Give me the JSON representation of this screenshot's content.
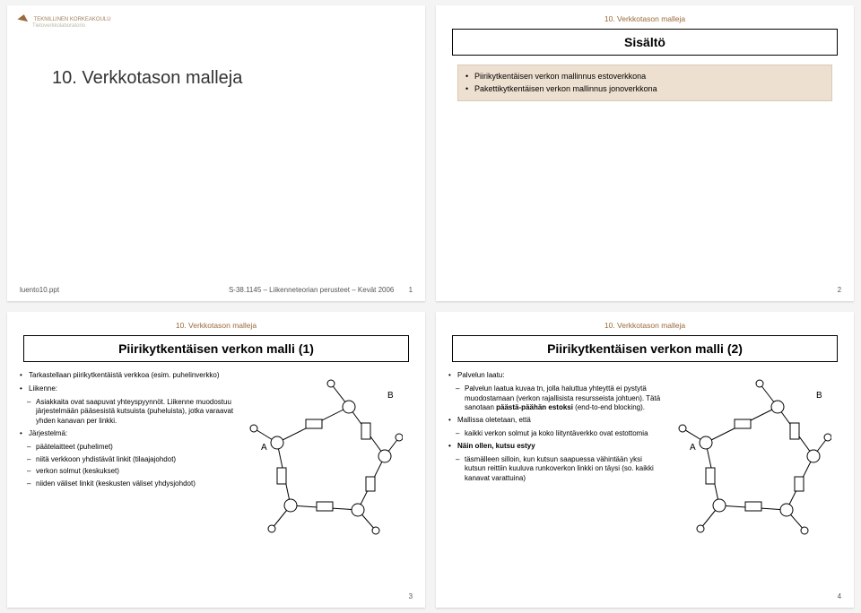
{
  "header": {
    "section_label": "10. Verkkotason malleja"
  },
  "slide1": {
    "logo_line1": "TEKNILLINEN KORKEAKOULU",
    "logo_line2": "Tietoverkkolaboratorio",
    "big_title": "10. Verkkotason malleja",
    "footer_left": "luento10.ppt",
    "footer_center": "S-38.1145 – Liikenneteorian perusteet – Kevät 2006",
    "footer_right": "1"
  },
  "slide2": {
    "title": "Sisältö",
    "bullets": [
      "Piirikytkentäisen verkon mallinnus estoverkkona",
      "Pakettikytkentäisen verkon mallinnus jonoverkkona"
    ],
    "page": "2"
  },
  "slide3": {
    "title": "Piirikytkentäisen verkon malli (1)",
    "bullets": {
      "intro": "Tarkastellaan piirikytkentäistä verkkoa (esim. puhelinverkko)",
      "liikenne_head": "Liikenne:",
      "liikenne_body": "Asiakkaita ovat saapuvat yhteyspyynnöt. Liikenne muodostuu järjestelmään pääsesistä kutsuista (puheluista), jotka varaavat yhden kanavan per linkki.",
      "jarj_head": "Järjestelmä:",
      "jarj_items": [
        "päätelaitteet (puhelimet)",
        "niitä verkkoon yhdistävät linkit (tilaajajohdot)",
        "verkon solmut (keskukset)",
        "niiden väliset linkit (keskusten väliset yhdysjohdot)"
      ]
    },
    "graph": {
      "A": "A",
      "B": "B"
    },
    "page": "3"
  },
  "slide4": {
    "title": "Piirikytkentäisen verkon malli (2)",
    "bullets": {
      "laatu_head": "Palvelun laatu:",
      "laatu_body1": "Palvelun laatua kuvaa tn, jolla haluttua yhteyttä ei pystytä muodostamaan (verkon rajallisista resursseista johtuen).",
      "laatu_body2_pre": "Tätä sanotaan ",
      "laatu_body2_bold": "päästä-päähän estoksi",
      "laatu_body2_post": " (end-to-end blocking).",
      "mallissa_head": "Mallissa oletetaan, että",
      "mallissa_item": "kaikki verkon solmut ja koko liityntäverkko ovat estottomia",
      "nain_head": "Näin ollen, kutsu estyy",
      "nain_item": "täsmälleen silloin, kun kutsun saapuessa vähintään yksi kutsun reittiin kuuluva runkoverkon linkki on täysi (so. kaikki kanavat varattuina)"
    },
    "graph": {
      "A": "A",
      "B": "B"
    },
    "page": "4"
  }
}
